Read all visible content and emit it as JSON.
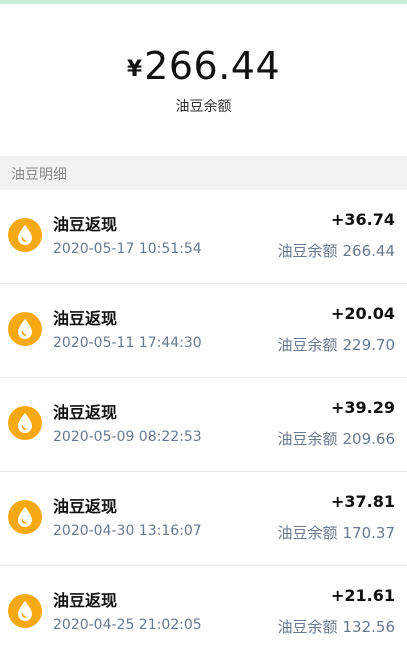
{
  "balance": {
    "currency_symbol": "¥",
    "amount": "266.44",
    "label": "油豆余额"
  },
  "section_title": "油豆明细",
  "colors": {
    "coin": "#f7a913",
    "secondary_text": "#6a7a8e",
    "section_bg": "#f2f2f2"
  },
  "transactions": [
    {
      "icon": "coin-drop-icon",
      "title": "油豆返现",
      "time": "2020-05-17 10:51:54",
      "delta": "+36.74",
      "after_label": "油豆余额",
      "after_value": "266.44"
    },
    {
      "icon": "coin-drop-icon",
      "title": "油豆返现",
      "time": "2020-05-11 17:44:30",
      "delta": "+20.04",
      "after_label": "油豆余额",
      "after_value": "229.70"
    },
    {
      "icon": "coin-drop-icon",
      "title": "油豆返现",
      "time": "2020-05-09 08:22:53",
      "delta": "+39.29",
      "after_label": "油豆余额",
      "after_value": "209.66"
    },
    {
      "icon": "coin-drop-icon",
      "title": "油豆返现",
      "time": "2020-04-30 13:16:07",
      "delta": "+37.81",
      "after_label": "油豆余额",
      "after_value": "170.37"
    },
    {
      "icon": "coin-drop-icon",
      "title": "油豆返现",
      "time": "2020-04-25 21:02:05",
      "delta": "+21.61",
      "after_label": "油豆余额",
      "after_value": "132.56"
    }
  ]
}
